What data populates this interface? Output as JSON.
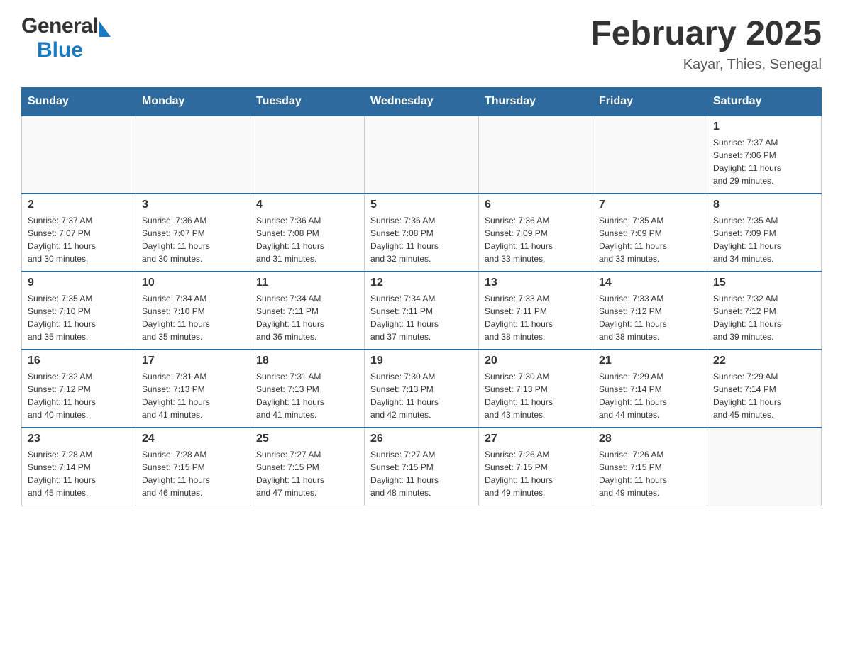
{
  "header": {
    "logo_general": "General",
    "logo_blue": "Blue",
    "title": "February 2025",
    "subtitle": "Kayar, Thies, Senegal"
  },
  "days_of_week": [
    "Sunday",
    "Monday",
    "Tuesday",
    "Wednesday",
    "Thursday",
    "Friday",
    "Saturday"
  ],
  "weeks": [
    {
      "days": [
        {
          "number": "",
          "info": ""
        },
        {
          "number": "",
          "info": ""
        },
        {
          "number": "",
          "info": ""
        },
        {
          "number": "",
          "info": ""
        },
        {
          "number": "",
          "info": ""
        },
        {
          "number": "",
          "info": ""
        },
        {
          "number": "1",
          "info": "Sunrise: 7:37 AM\nSunset: 7:06 PM\nDaylight: 11 hours\nand 29 minutes."
        }
      ]
    },
    {
      "days": [
        {
          "number": "2",
          "info": "Sunrise: 7:37 AM\nSunset: 7:07 PM\nDaylight: 11 hours\nand 30 minutes."
        },
        {
          "number": "3",
          "info": "Sunrise: 7:36 AM\nSunset: 7:07 PM\nDaylight: 11 hours\nand 30 minutes."
        },
        {
          "number": "4",
          "info": "Sunrise: 7:36 AM\nSunset: 7:08 PM\nDaylight: 11 hours\nand 31 minutes."
        },
        {
          "number": "5",
          "info": "Sunrise: 7:36 AM\nSunset: 7:08 PM\nDaylight: 11 hours\nand 32 minutes."
        },
        {
          "number": "6",
          "info": "Sunrise: 7:36 AM\nSunset: 7:09 PM\nDaylight: 11 hours\nand 33 minutes."
        },
        {
          "number": "7",
          "info": "Sunrise: 7:35 AM\nSunset: 7:09 PM\nDaylight: 11 hours\nand 33 minutes."
        },
        {
          "number": "8",
          "info": "Sunrise: 7:35 AM\nSunset: 7:09 PM\nDaylight: 11 hours\nand 34 minutes."
        }
      ]
    },
    {
      "days": [
        {
          "number": "9",
          "info": "Sunrise: 7:35 AM\nSunset: 7:10 PM\nDaylight: 11 hours\nand 35 minutes."
        },
        {
          "number": "10",
          "info": "Sunrise: 7:34 AM\nSunset: 7:10 PM\nDaylight: 11 hours\nand 35 minutes."
        },
        {
          "number": "11",
          "info": "Sunrise: 7:34 AM\nSunset: 7:11 PM\nDaylight: 11 hours\nand 36 minutes."
        },
        {
          "number": "12",
          "info": "Sunrise: 7:34 AM\nSunset: 7:11 PM\nDaylight: 11 hours\nand 37 minutes."
        },
        {
          "number": "13",
          "info": "Sunrise: 7:33 AM\nSunset: 7:11 PM\nDaylight: 11 hours\nand 38 minutes."
        },
        {
          "number": "14",
          "info": "Sunrise: 7:33 AM\nSunset: 7:12 PM\nDaylight: 11 hours\nand 38 minutes."
        },
        {
          "number": "15",
          "info": "Sunrise: 7:32 AM\nSunset: 7:12 PM\nDaylight: 11 hours\nand 39 minutes."
        }
      ]
    },
    {
      "days": [
        {
          "number": "16",
          "info": "Sunrise: 7:32 AM\nSunset: 7:12 PM\nDaylight: 11 hours\nand 40 minutes."
        },
        {
          "number": "17",
          "info": "Sunrise: 7:31 AM\nSunset: 7:13 PM\nDaylight: 11 hours\nand 41 minutes."
        },
        {
          "number": "18",
          "info": "Sunrise: 7:31 AM\nSunset: 7:13 PM\nDaylight: 11 hours\nand 41 minutes."
        },
        {
          "number": "19",
          "info": "Sunrise: 7:30 AM\nSunset: 7:13 PM\nDaylight: 11 hours\nand 42 minutes."
        },
        {
          "number": "20",
          "info": "Sunrise: 7:30 AM\nSunset: 7:13 PM\nDaylight: 11 hours\nand 43 minutes."
        },
        {
          "number": "21",
          "info": "Sunrise: 7:29 AM\nSunset: 7:14 PM\nDaylight: 11 hours\nand 44 minutes."
        },
        {
          "number": "22",
          "info": "Sunrise: 7:29 AM\nSunset: 7:14 PM\nDaylight: 11 hours\nand 45 minutes."
        }
      ]
    },
    {
      "days": [
        {
          "number": "23",
          "info": "Sunrise: 7:28 AM\nSunset: 7:14 PM\nDaylight: 11 hours\nand 45 minutes."
        },
        {
          "number": "24",
          "info": "Sunrise: 7:28 AM\nSunset: 7:15 PM\nDaylight: 11 hours\nand 46 minutes."
        },
        {
          "number": "25",
          "info": "Sunrise: 7:27 AM\nSunset: 7:15 PM\nDaylight: 11 hours\nand 47 minutes."
        },
        {
          "number": "26",
          "info": "Sunrise: 7:27 AM\nSunset: 7:15 PM\nDaylight: 11 hours\nand 48 minutes."
        },
        {
          "number": "27",
          "info": "Sunrise: 7:26 AM\nSunset: 7:15 PM\nDaylight: 11 hours\nand 49 minutes."
        },
        {
          "number": "28",
          "info": "Sunrise: 7:26 AM\nSunset: 7:15 PM\nDaylight: 11 hours\nand 49 minutes."
        },
        {
          "number": "",
          "info": ""
        }
      ]
    }
  ]
}
